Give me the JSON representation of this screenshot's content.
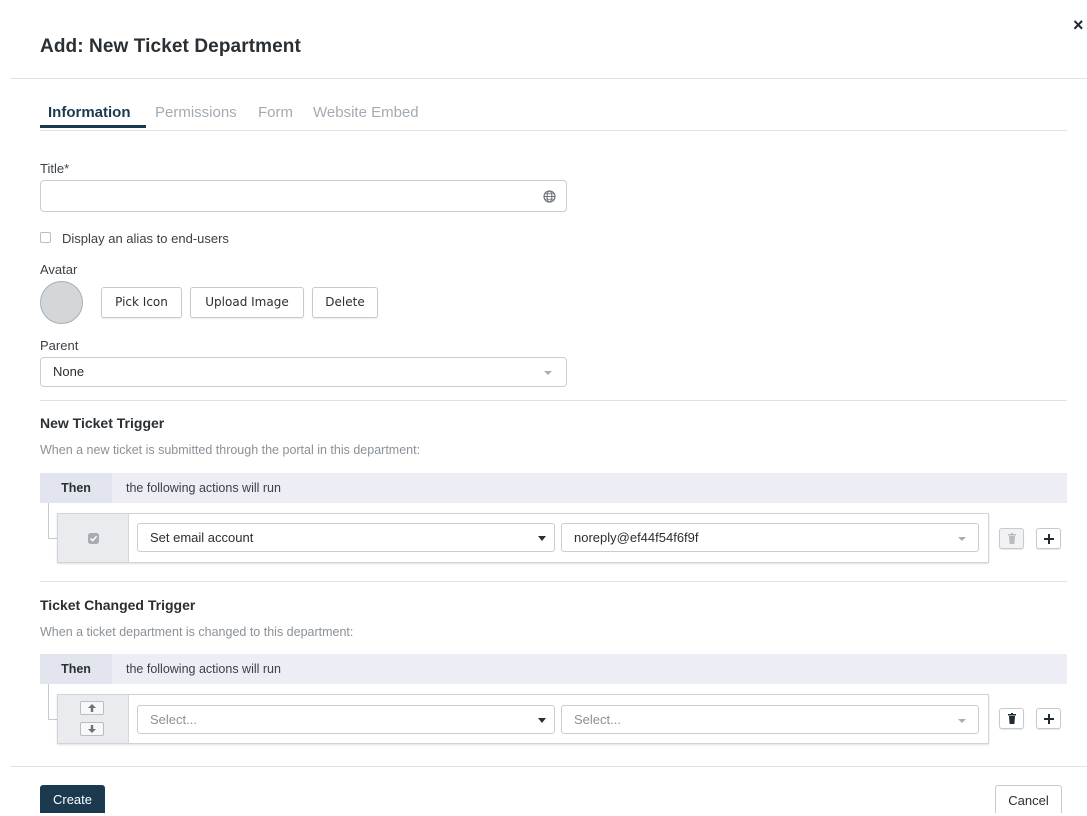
{
  "modal": {
    "title": "Add: New Ticket Department",
    "close_glyph": "×"
  },
  "tabs": [
    {
      "label": "Information",
      "active": true
    },
    {
      "label": "Permissions",
      "active": false
    },
    {
      "label": "Form",
      "active": false
    },
    {
      "label": "Website Embed",
      "active": false
    }
  ],
  "form": {
    "title_label": "Title*",
    "title_value": "",
    "title_icon": "globe-icon",
    "alias_checkbox_label": "Display an alias to end-users",
    "alias_checked": false,
    "avatar_label": "Avatar",
    "avatar_buttons": {
      "pick_icon": "Pick Icon",
      "upload_image": "Upload Image",
      "delete": "Delete"
    },
    "parent_label": "Parent",
    "parent_value": "None"
  },
  "new_ticket_trigger": {
    "title": "New Ticket Trigger",
    "description": "When a new ticket is submitted through the portal in this department:",
    "then_label": "Then",
    "then_text": "the following actions will run",
    "action": {
      "checked": true,
      "action_value": "Set email account",
      "target_value": "noreply@ef44f54f6f9f"
    }
  },
  "ticket_changed_trigger": {
    "title": "Ticket Changed Trigger",
    "description": "When a ticket department is changed to this department:",
    "then_label": "Then",
    "then_text": "the following actions will run",
    "action": {
      "action_placeholder": "Select...",
      "target_placeholder": "Select..."
    }
  },
  "footer": {
    "create_label": "Create",
    "cancel_label": "Cancel"
  },
  "colors": {
    "primary": "#1c3a4f",
    "muted_text": "#a3abb2",
    "then_bar": "#edeef5",
    "border": "#c9ced3"
  }
}
